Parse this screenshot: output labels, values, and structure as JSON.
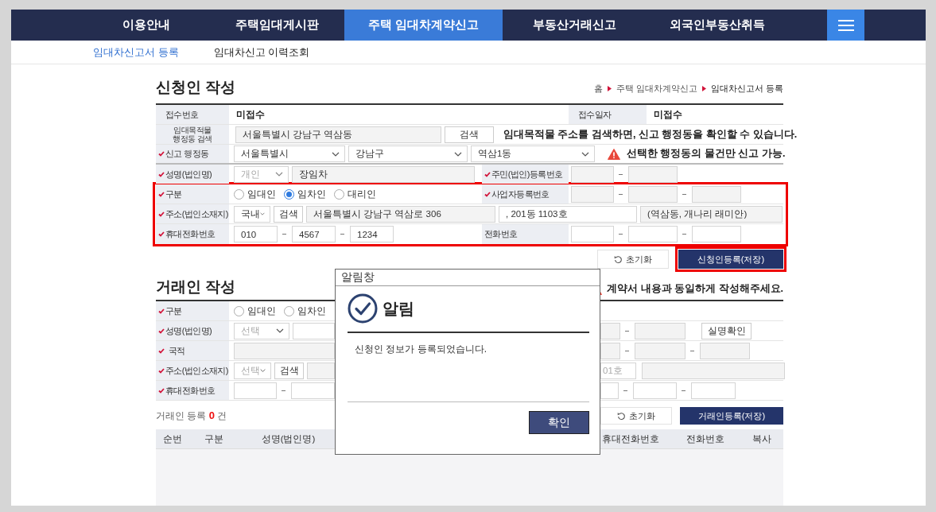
{
  "nav_tabs": [
    {
      "label": "이용안내",
      "selected": false
    },
    {
      "label": "주택임대게시판",
      "selected": false
    },
    {
      "label": "주택 임대차계약신고",
      "selected": true
    },
    {
      "label": "부동산거래신고",
      "selected": false
    },
    {
      "label": "외국인부동산취득",
      "selected": false
    }
  ],
  "sub_tabs": [
    {
      "label": "임대차신고서 등록",
      "selected": true
    },
    {
      "label": "임대차신고 이력조회",
      "selected": false
    }
  ],
  "applicant": {
    "title": "신청인 작성",
    "breadcrumb": [
      "홈",
      "주택 임대차계약신고",
      "임대차신고서 등록"
    ],
    "receipt_no": {
      "label": {
        "text": "접수번호",
        "required": false
      },
      "value": "미접수"
    },
    "receipt_date": {
      "label": {
        "text": "접수일자",
        "required": false
      },
      "value": "미접수"
    },
    "target_search": {
      "label": {
        "text": "임대목적물\n행정동 검색",
        "required": false
      },
      "value": "서울특별시 강남구 역삼동",
      "button": "검색",
      "hint": "임대목적물 주소를 검색하면, 신고 행정동을 확인할 수 있습니다."
    },
    "district": {
      "label": {
        "text": "신고 행정동",
        "required": true
      },
      "selects": [
        "서울특별시",
        "강남구",
        "역삼1동"
      ],
      "warning": "선택한 행정동의 물건만 신고 가능."
    },
    "name": {
      "label": {
        "text": "성명(법인명)",
        "required": true
      },
      "type_select": {
        "value": "개인",
        "disabled": true
      },
      "value": "장임차"
    },
    "resident_no": {
      "label": {
        "text": "주민(법인)등록번호",
        "required": true
      }
    },
    "highlighted": true,
    "division": {
      "label": {
        "text": "구분",
        "required": true
      },
      "options": [
        {
          "label": "임대인",
          "selected": false
        },
        {
          "label": "임차인",
          "selected": true
        },
        {
          "label": "대리인",
          "selected": false
        }
      ]
    },
    "business_no": {
      "label": {
        "text": "사업자등록번호",
        "required": true
      }
    },
    "address": {
      "label": {
        "text": "주소(법인소재지)",
        "required": true
      },
      "region": "국내",
      "button": "검색",
      "road": "서울특별시 강남구 역삼로 306",
      "detail": ", 201동 1103호",
      "extra": "(역삼동, 개나리 래미안)"
    },
    "mobile": {
      "label": {
        "text": "휴대전화번호",
        "required": true
      },
      "parts": [
        "010",
        "4567",
        "1234"
      ]
    },
    "phone": {
      "label": {
        "text": "전화번호",
        "required": false
      }
    },
    "reset_button": "초기화",
    "save_button": {
      "label": "신청인등록(저장)",
      "highlighted": true
    }
  },
  "party": {
    "title": "거래인 작성",
    "warning": "계약서 내용과 동일하게 작성해주세요.",
    "division": {
      "label": {
        "text": "구분",
        "required": true
      },
      "options": [
        {
          "label": "임대인",
          "selected": false
        },
        {
          "label": "임차인",
          "selected": false
        }
      ]
    },
    "name": {
      "label": {
        "text": "성명(법인명)",
        "required": true
      },
      "select": "선택",
      "button": "실명확인"
    },
    "nationality": {
      "label": {
        "text": "국적",
        "required": true
      }
    },
    "address": {
      "label": {
        "text": "주소(법인소재지)",
        "required": true
      },
      "select": "선택",
      "button": "검색",
      "detail": "01호"
    },
    "mobile": {
      "label": {
        "text": "휴대전화번호",
        "required": true
      }
    },
    "count": {
      "prefix": "거래인 등록",
      "number": "0",
      "suffix": "건"
    },
    "reset_button": "초기화",
    "save_button": "거래인등록(저장)",
    "columns_left": [
      "순번",
      "구분",
      "성명(법인명)"
    ],
    "columns_right": [
      "휴대전화번호",
      "전화번호",
      "복사"
    ]
  },
  "dialog": {
    "title": "알림창",
    "heading": "알림",
    "message": "신청인 정보가 등록되었습니다.",
    "button": "확인"
  }
}
